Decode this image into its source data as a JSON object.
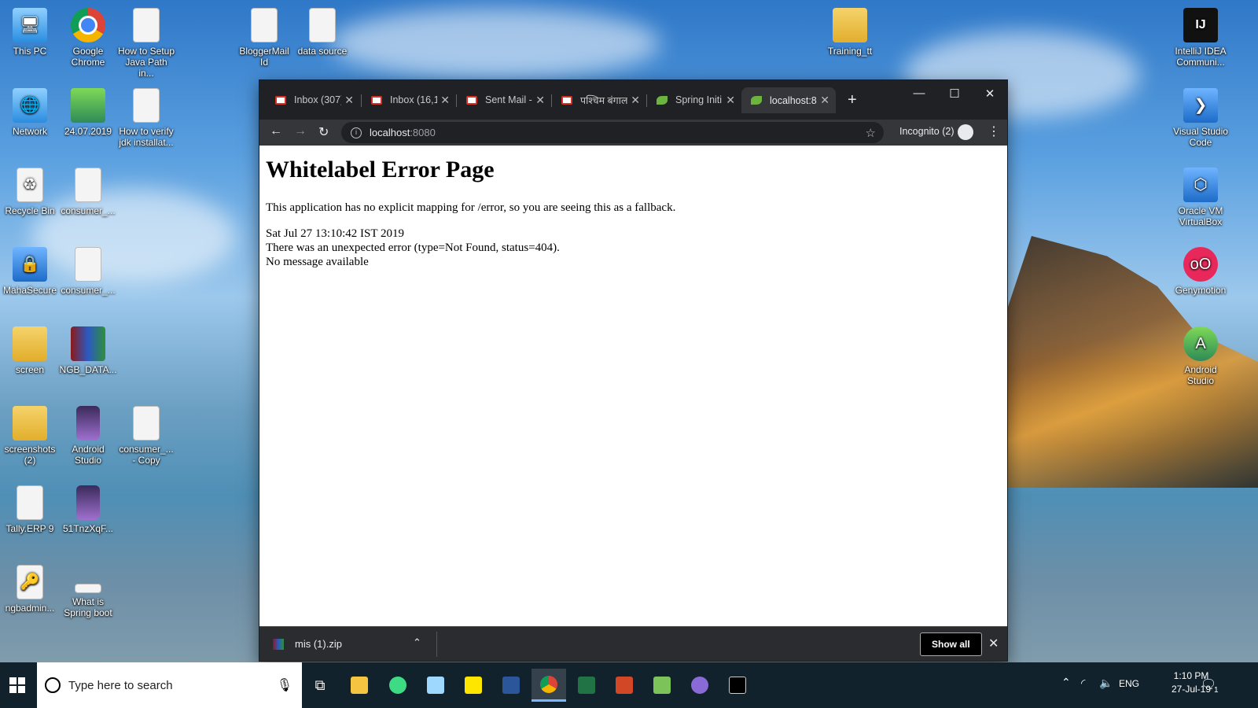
{
  "desktop": {
    "icons_left": [
      {
        "label": "This PC",
        "icon": "this-pc-icon"
      },
      {
        "label": "Google Chrome",
        "icon": "chrome-icon"
      },
      {
        "label": "How to Setup Java Path in...",
        "icon": "image-icon"
      },
      {
        "label": "BloggerMail Id",
        "icon": "text-file-icon"
      },
      {
        "label": "data source",
        "icon": "text-file-icon"
      },
      {
        "label": "Training_tt",
        "icon": "folder-icon"
      },
      {
        "label": "Network",
        "icon": "network-icon"
      },
      {
        "label": "24.07.2019",
        "icon": "spreadsheet-icon"
      },
      {
        "label": "How to verify jdk installat...",
        "icon": "image-icon"
      },
      {
        "label": "Recycle Bin",
        "icon": "recycle-bin-icon"
      },
      {
        "label": "consumer_...",
        "icon": "text-file-icon"
      },
      {
        "label": "MahaSecure",
        "icon": "lock-icon"
      },
      {
        "label": "consumer_...",
        "icon": "text-file-icon"
      },
      {
        "label": "screen",
        "icon": "folder-icon"
      },
      {
        "label": "NGB_DATA...",
        "icon": "winrar-icon"
      },
      {
        "label": "screenshots (2)",
        "icon": "folder-icon"
      },
      {
        "label": "Android Studio",
        "icon": "phone-image-icon"
      },
      {
        "label": "consumer_... - Copy",
        "icon": "text-file-icon"
      },
      {
        "label": "Tally.ERP 9",
        "icon": "tally-icon"
      },
      {
        "label": "51TnzXqF...",
        "icon": "phone-image-icon"
      },
      {
        "label": "ngbadmin...",
        "icon": "certificate-icon"
      },
      {
        "label": "What is Spring boot",
        "icon": "image-icon"
      }
    ],
    "icons_right": [
      {
        "label": "IntelliJ IDEA Communi...",
        "icon": "intellij-icon"
      },
      {
        "label": "Visual Studio Code",
        "icon": "vscode-icon"
      },
      {
        "label": "Oracle VM VirtualBox",
        "icon": "virtualbox-icon"
      },
      {
        "label": "Genymotion",
        "icon": "genymotion-icon"
      },
      {
        "label": "Android Studio",
        "icon": "android-studio-icon"
      }
    ]
  },
  "browser": {
    "tabs": [
      {
        "label": "Inbox (307)",
        "favicon": "gmail-icon",
        "active": false
      },
      {
        "label": "Inbox (16,1",
        "favicon": "gmail-icon",
        "active": false
      },
      {
        "label": "Sent Mail -",
        "favicon": "gmail-icon",
        "active": false
      },
      {
        "label": "पश्चिम बंगाल",
        "favicon": "gmail-icon",
        "active": false
      },
      {
        "label": "Spring Initi",
        "favicon": "spring-icon",
        "active": false
      },
      {
        "label": "localhost:8",
        "favicon": "spring-icon",
        "active": true
      }
    ],
    "url_host": "localhost",
    "url_port": ":8080",
    "incognito_label": "Incognito (2)",
    "page": {
      "title": "Whitelabel Error Page",
      "line1": "This application has no explicit mapping for /error, so you are seeing this as a fallback.",
      "timestamp": "Sat Jul 27 13:10:42 IST 2019",
      "error": "There was an unexpected error (type=Not Found, status=404).",
      "message": "No message available"
    },
    "download": {
      "filename": "mis (1).zip",
      "show_all_label": "Show all"
    }
  },
  "taskbar": {
    "search_placeholder": "Type here to search",
    "language": "ENG",
    "time": "1:10 PM",
    "date": "27-Jul-19",
    "notification_count": "1"
  },
  "colors": {
    "tabbar": "#202124",
    "toolbar": "#35363a",
    "taskbar": "#12222d"
  }
}
